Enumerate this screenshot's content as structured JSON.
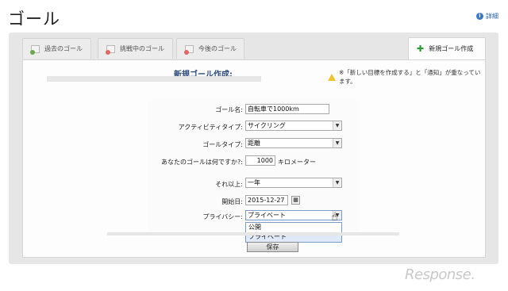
{
  "header": {
    "title": "ゴール",
    "help_label": "詳細",
    "help_icon": "info-icon"
  },
  "tabs": [
    {
      "label": "過去のゴール",
      "icon": "goal-past-icon"
    },
    {
      "label": "挑戦中のゴール",
      "icon": "goal-active-icon"
    },
    {
      "label": "今後のゴール",
      "icon": "goal-future-icon"
    },
    {
      "label": "新規ゴール作成",
      "icon": "plus-icon",
      "active": true
    }
  ],
  "form": {
    "title": "新規ゴール作成:",
    "warning": "※「新しい目標を作成する」と「通知」が重なっています。",
    "goal_name_label": "ゴール名:",
    "goal_name_value": "自転車で1000km",
    "activity_type_label": "アクティビティタイプ:",
    "activity_type_value": "サイクリング",
    "goal_type_label": "ゴールタイプ:",
    "goal_type_value": "距離",
    "target_label": "あなたのゴールは何ですか?:",
    "target_value": "1000",
    "target_unit": "キロメーター",
    "more_than_label": "それ以上:",
    "more_than_value": "一年",
    "start_date_label": "開始日:",
    "start_date_value": "2015-12-27",
    "privacy_label": "プライバシー:",
    "privacy_value": "プライベート",
    "privacy_options": [
      "公開",
      "プライベート"
    ],
    "save_label": "保存"
  },
  "watermark": "Response."
}
